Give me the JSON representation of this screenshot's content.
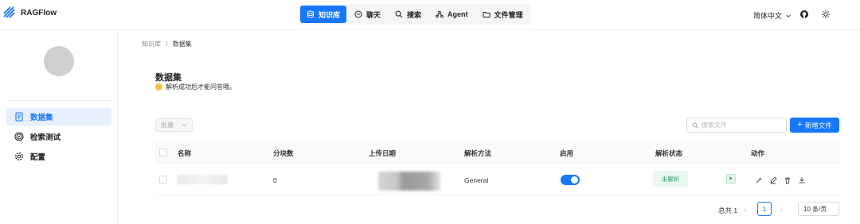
{
  "header": {
    "logo_text": "RAGFlow",
    "nav": [
      {
        "label": "知识库",
        "icon": "database-icon",
        "active": true
      },
      {
        "label": "聊天",
        "icon": "chat-icon",
        "active": false
      },
      {
        "label": "搜索",
        "icon": "search-icon",
        "active": false
      },
      {
        "label": "Agent",
        "icon": "agent-icon",
        "active": false
      },
      {
        "label": "文件管理",
        "icon": "folder-icon",
        "active": false
      }
    ],
    "language": "简体中文"
  },
  "sidebar": {
    "items": [
      {
        "label": "数据集",
        "icon": "file-icon",
        "active": true
      },
      {
        "label": "检索测试",
        "icon": "target-icon",
        "active": false
      },
      {
        "label": "配置",
        "icon": "gear-icon",
        "active": false
      }
    ]
  },
  "breadcrumb": {
    "parent": "知识库",
    "separator": "/",
    "current": "数据集"
  },
  "main": {
    "title": "数据集",
    "subtitle": "解析成功后才能问答哦。",
    "batch_label": "批量",
    "search_placeholder": "搜索文件",
    "add_button": "新增文件"
  },
  "table": {
    "columns": [
      "名称",
      "分块数",
      "上传日期",
      "解析方法",
      "启用",
      "解析状态",
      "动作"
    ],
    "rows": [
      {
        "chunks": "0",
        "method": "General",
        "enabled": true,
        "status": "未解析"
      }
    ]
  },
  "pagination": {
    "total": "总共 1",
    "current": "1",
    "page_size": "10 条/页"
  },
  "colors": {
    "accent": "#1677ff",
    "status_bg": "#e8f8ef",
    "status_fg": "#2e9b5f"
  }
}
